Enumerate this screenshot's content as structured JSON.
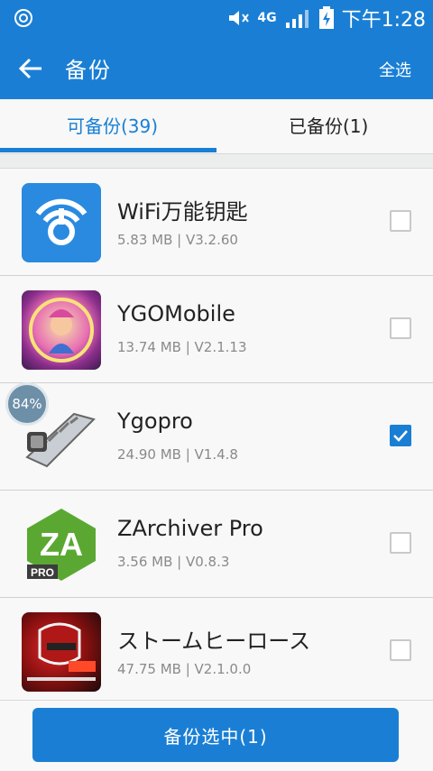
{
  "status_bar": {
    "network": "4G",
    "time": "下午1:28"
  },
  "app_bar": {
    "title": "备份",
    "select_all": "全选"
  },
  "tabs": [
    {
      "label": "可备份(39)",
      "active": true
    },
    {
      "label": "已备份(1)",
      "active": false
    }
  ],
  "apps": [
    {
      "name": "WiFi万能钥匙",
      "meta": "5.83 MB | V3.2.60",
      "checked": false,
      "icon": "wifi-key-icon"
    },
    {
      "name": "YGOMobile",
      "meta": "13.74 MB | V2.1.13",
      "checked": false,
      "icon": "ygomobile-icon"
    },
    {
      "name": "Ygopro",
      "meta": "24.90 MB | V1.4.8",
      "checked": true,
      "icon": "ygopro-icon"
    },
    {
      "name": "ZArchiver Pro",
      "meta": "3.56 MB | V0.8.3",
      "checked": false,
      "icon": "zarchiver-icon"
    },
    {
      "name": "ストームヒーロース",
      "meta": "47.75 MB | V2.1.0.0",
      "checked": false,
      "icon": "storm-heroes-icon"
    }
  ],
  "progress_badge": "84%",
  "footer": {
    "backup_button": "备份选中(1)"
  },
  "colors": {
    "accent": "#1a7fd4",
    "background": "#f7f8f7",
    "text_secondary": "#8a8a8a"
  }
}
